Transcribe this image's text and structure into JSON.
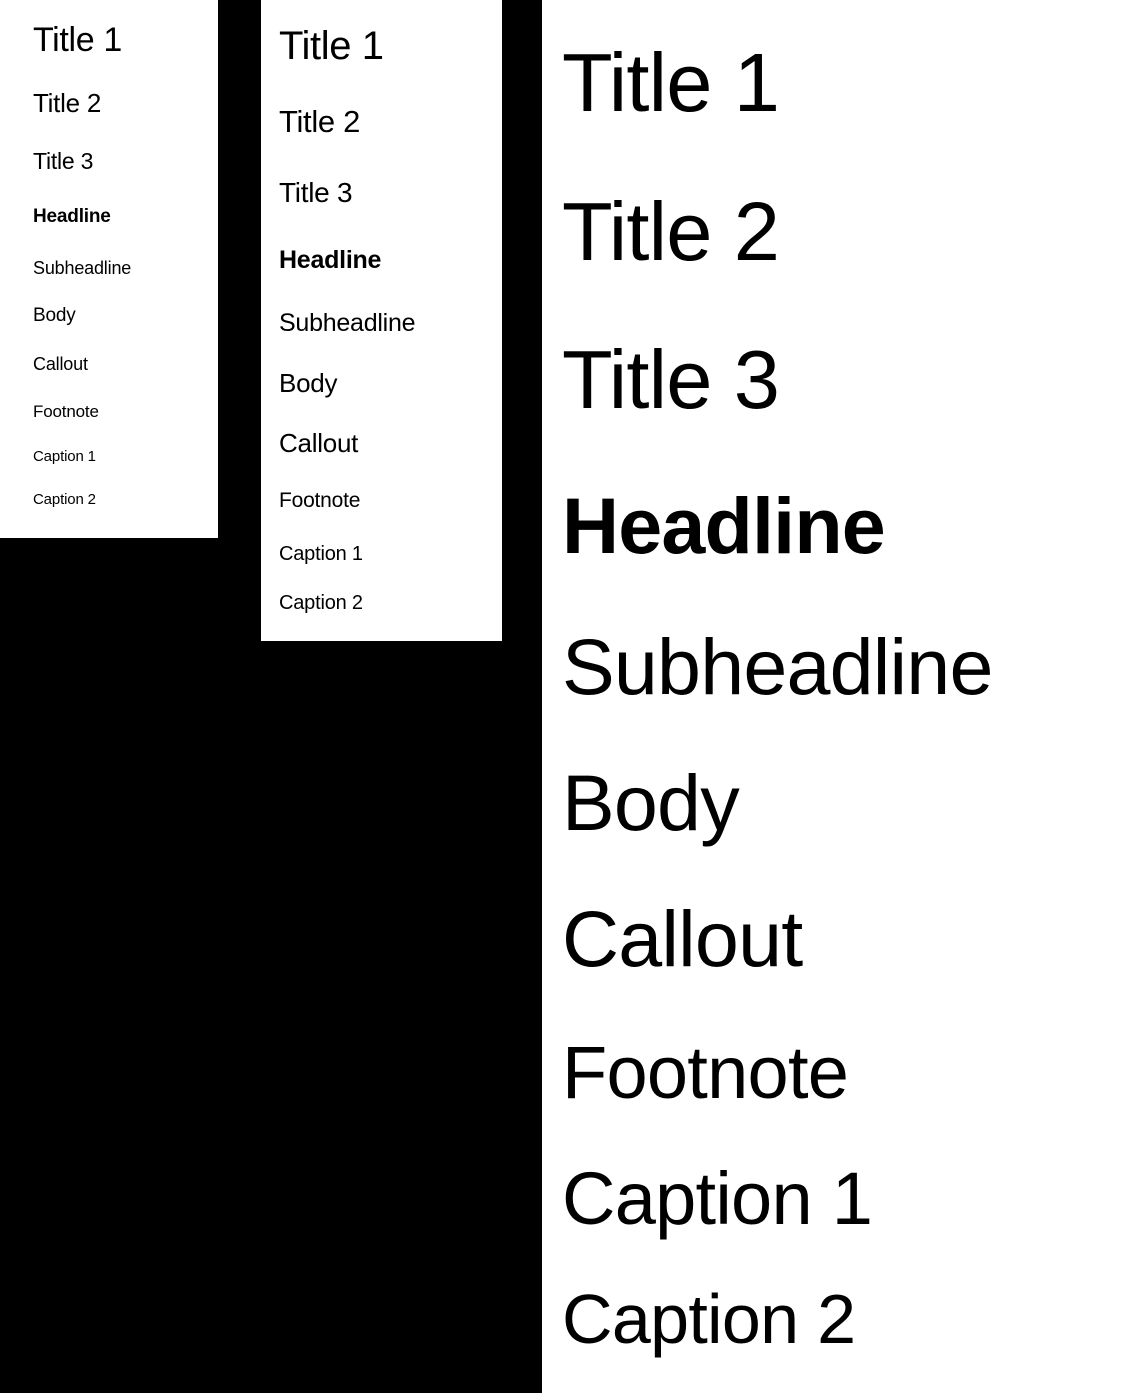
{
  "background_color": "#000000",
  "panel_background_color": "#ffffff",
  "text_color": "#000000",
  "styles": [
    {
      "key": "title1",
      "label": "Title 1",
      "weight": "regular"
    },
    {
      "key": "title2",
      "label": "Title 2",
      "weight": "regular"
    },
    {
      "key": "title3",
      "label": "Title 3",
      "weight": "regular"
    },
    {
      "key": "headline",
      "label": "Headline",
      "weight": "bold"
    },
    {
      "key": "subheadline",
      "label": "Subheadline",
      "weight": "regular"
    },
    {
      "key": "body",
      "label": "Body",
      "weight": "regular"
    },
    {
      "key": "callout",
      "label": "Callout",
      "weight": "regular"
    },
    {
      "key": "footnote",
      "label": "Footnote",
      "weight": "regular"
    },
    {
      "key": "caption1",
      "label": "Caption 1",
      "weight": "regular"
    },
    {
      "key": "caption2",
      "label": "Caption 2",
      "weight": "regular"
    }
  ],
  "panels": [
    {
      "id": "small",
      "rows": [
        "Title 1",
        "Title 2",
        "Title 3",
        "Headline",
        "Subheadline",
        "Body",
        "Callout",
        "Footnote",
        "Caption 1",
        "Caption 2"
      ]
    },
    {
      "id": "medium",
      "rows": [
        "Title 1",
        "Title 2",
        "Title 3",
        "Headline",
        "Subheadline",
        "Body",
        "Callout",
        "Footnote",
        "Caption 1",
        "Caption 2"
      ]
    },
    {
      "id": "large",
      "rows": [
        "Title 1",
        "Title 2",
        "Title 3",
        "Headline",
        "Subheadline",
        "Body",
        "Callout",
        "Footnote",
        "Caption 1",
        "Caption 2"
      ]
    }
  ]
}
